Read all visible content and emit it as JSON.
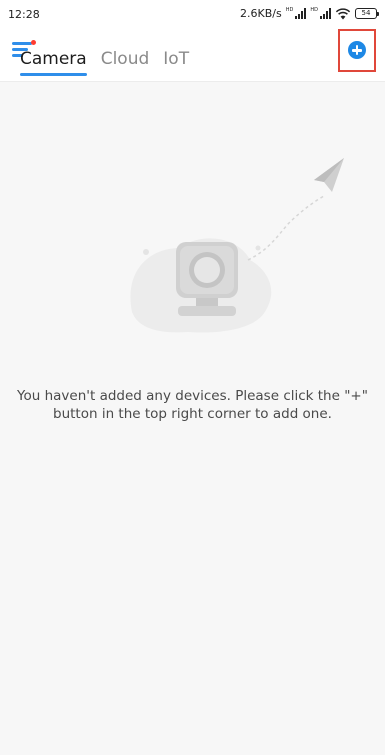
{
  "status_bar": {
    "time": "12:28",
    "network_speed": "2.6KB/s",
    "signal_hd_label": "HD",
    "battery_level": "54",
    "signal_strength_bars": 4,
    "wifi_icon": "wifi-icon"
  },
  "top_bar": {
    "menu_icon": "menu-icon",
    "add_icon": "plus-circle-icon",
    "accent_color": "#2f8eea",
    "highlight_color": "#e0473a"
  },
  "tabs": [
    {
      "label": "Camera",
      "active": true
    },
    {
      "label": "Cloud",
      "active": false
    },
    {
      "label": "IoT",
      "active": false
    }
  ],
  "empty_state": {
    "illustration_icon": "camera-with-paper-plane-icon",
    "message": "You haven't added any devices. Please click the \"+\" button in the top right corner to add one."
  }
}
